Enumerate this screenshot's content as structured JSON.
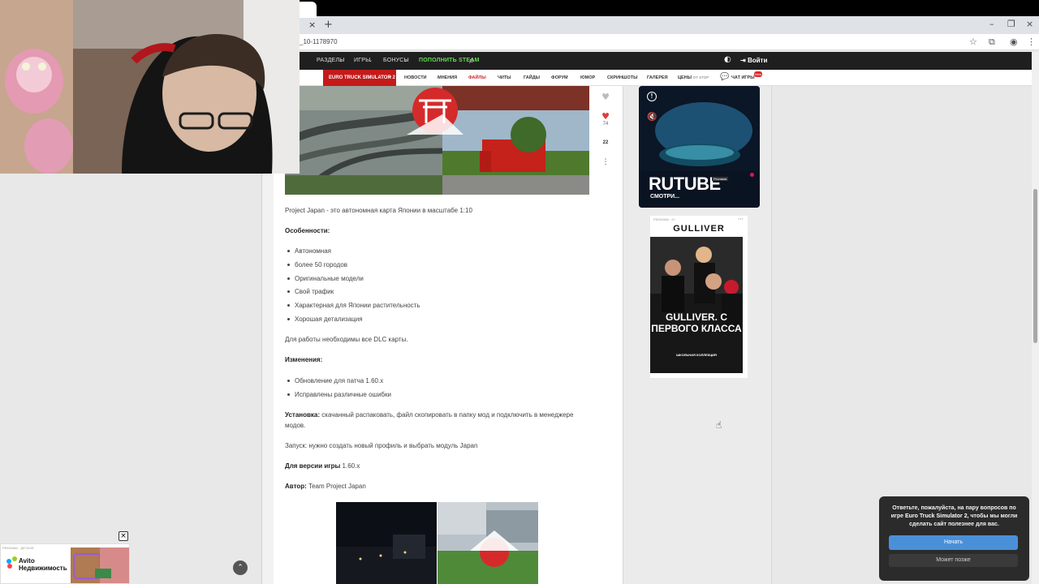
{
  "browser": {
    "url": "_10-1178970",
    "tab_close": "×",
    "new_tab": "+",
    "window_controls": [
      "–",
      "❐",
      "×"
    ],
    "toolbar_icons": [
      "star-icon",
      "extensions-icon",
      "profile-icon",
      "menu-icon"
    ]
  },
  "header": {
    "menu": [
      "РАЗДЕЛЫ",
      "ИГРЫ",
      "БОНУСЫ"
    ],
    "topup": "ПОПОЛНИТЬ STEAM",
    "login": "Войти"
  },
  "subnav": {
    "game": "EURO TRUCK SIMULATOR 2",
    "items": [
      "НОВОСТИ",
      "МНЕНИЯ",
      "ФАЙЛЫ",
      "ЧИТЫ",
      "ГАЙДЫ",
      "ФОРУМ",
      "ЮМОР",
      "СКРИНШОТЫ",
      "ГАЛЕРЕЯ",
      "ЦЕНЫ"
    ],
    "prices_suffix": "ОТ STOP",
    "chat": "ЧАТ ИГРЫ",
    "chat_badge": "New"
  },
  "actions": {
    "like_count": "74",
    "comments_count": "22"
  },
  "article": {
    "intro": "Project Japan - это автономная карта Японии в масштабе 1:10",
    "features_title": "Особенности:",
    "features": [
      "Автономная",
      "более 50 городов",
      "Оригинальные модели",
      "Свой трафик",
      "Характерная для Японии растительность",
      "Хорошая детализация"
    ],
    "dlc_note": "Для работы необходимы все DLC карты.",
    "changes_title": "Изменения:",
    "changes": [
      "Обновление для патча 1.60.x",
      "Исправлены различные ошибки"
    ],
    "install_label": "Установка:",
    "install_text": " скачанный распаковать, файл скопировать в папку мод и подключить в менеджере",
    "install_text2": "модов.",
    "launch": "Запуск: нужно создать новый профиль и выбрать модуль Japan",
    "version_label": "Для версии игры",
    "version_value": " 1.60.x",
    "author_label": "Автор:",
    "author_value": " Team Project Japan"
  },
  "ads": {
    "rutube_logo": "RUTUBE",
    "rutube_cta": "СМОТРИ...",
    "rutube_label": "Реклама",
    "gulliver_top": "РЕКЛАМА · 0+",
    "gulliver_brand": "GULLIVER",
    "gulliver_headline": "GULLIVER. С ПЕРВОГО КЛАССА",
    "gulliver_sub": "ШКОЛЬНАЯ КОЛЛЕКЦИЯ",
    "avito_label": "РЕКЛАМА · ДЕТАЛИ",
    "avito_brand": "Avito Недвижимость",
    "avito_close": "×"
  },
  "survey": {
    "text_before": "Ответьте, пожалуйста, на пару вопросов по игре ",
    "text_game": "Euro Truck Simulator 2",
    "text_after": ", чтобы мы могли сделать сайт полезнее для вас.",
    "start": "Начать",
    "later": "Может позже"
  }
}
